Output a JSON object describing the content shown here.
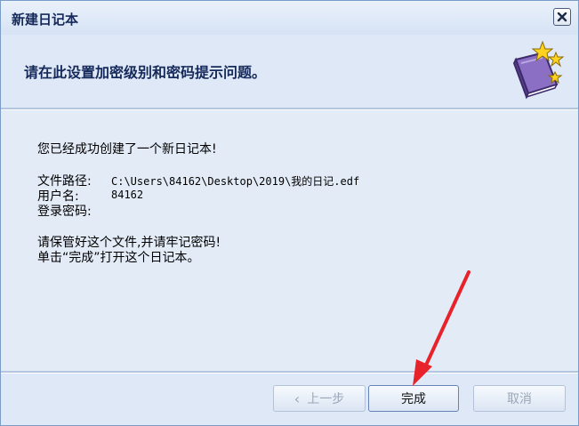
{
  "window": {
    "title": "新建日记本",
    "close_glyph": "✕"
  },
  "header": {
    "instruction": "请在此设置加密级别和密码提示问题。",
    "icon": "diary-book-with-stars-icon"
  },
  "content": {
    "success_message": "您已经成功创建了一个新日记本!",
    "file_path_label": "文件路径:",
    "file_path_value": "C:\\Users\\84162\\Desktop\\2019\\我的日记.edf",
    "username_label": "用户名:",
    "username_value": "84162",
    "password_label": "登录密码:",
    "password_value": "",
    "keep_notice": "请保管好这个文件,并请牢记密码!",
    "finish_hint": "单击“完成”打开这个日记本。"
  },
  "footer": {
    "back_label": "上一步",
    "back_glyph": "‹",
    "finish_label": "完成",
    "cancel_label": "取消"
  },
  "colors": {
    "accent": "#15295a",
    "annotation_arrow": "#e8222a"
  }
}
